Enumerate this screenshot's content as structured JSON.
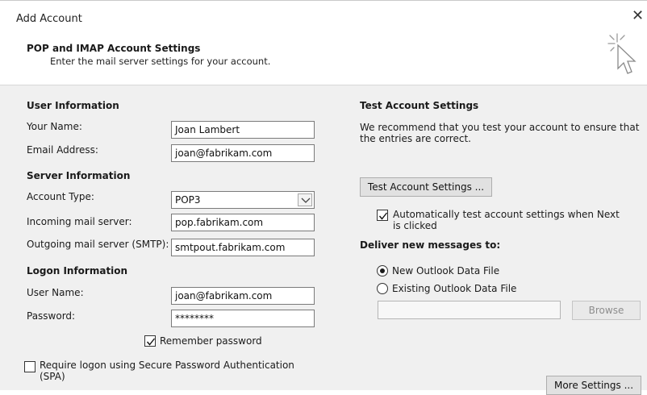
{
  "window": {
    "title": "Add Account",
    "close_glyph": "✕"
  },
  "header": {
    "title": "POP and IMAP Account Settings",
    "subtitle": "Enter the mail server settings for your account.",
    "art_icon": "click-cursor-icon"
  },
  "user_info": {
    "heading": "User Information",
    "name_label": "Your Name:",
    "name_value": "Joan Lambert",
    "email_label": "Email Address:",
    "email_value": "joan@fabrikam.com"
  },
  "server_info": {
    "heading": "Server Information",
    "account_type_label": "Account Type:",
    "account_type_value": "POP3",
    "incoming_label": "Incoming mail server:",
    "incoming_value": "pop.fabrikam.com",
    "outgoing_label": "Outgoing mail server (SMTP):",
    "outgoing_value": "smtpout.fabrikam.com"
  },
  "logon_info": {
    "heading": "Logon Information",
    "username_label": "User Name:",
    "username_value": "joan@fabrikam.com",
    "password_label": "Password:",
    "password_value": "********",
    "remember_label": "Remember password",
    "remember_checked": true,
    "spa_label_line1": "Require logon using Secure Password Authentication",
    "spa_label_line2": "(SPA)",
    "spa_checked": false
  },
  "test_settings": {
    "heading": "Test Account Settings",
    "description_line1": "We recommend that you test your account to ensure that",
    "description_line2": "the entries are correct.",
    "test_button": "Test Account Settings ...",
    "auto_test_line1": "Automatically test account settings when Next",
    "auto_test_line2": "is clicked",
    "auto_test_checked": true
  },
  "deliver": {
    "heading": "Deliver new messages to:",
    "new_file_label": "New Outlook Data File",
    "existing_file_label": "Existing Outlook Data File",
    "selected": "new",
    "path_value": "",
    "browse_button": "Browse"
  },
  "more_settings_button": "More Settings ..."
}
